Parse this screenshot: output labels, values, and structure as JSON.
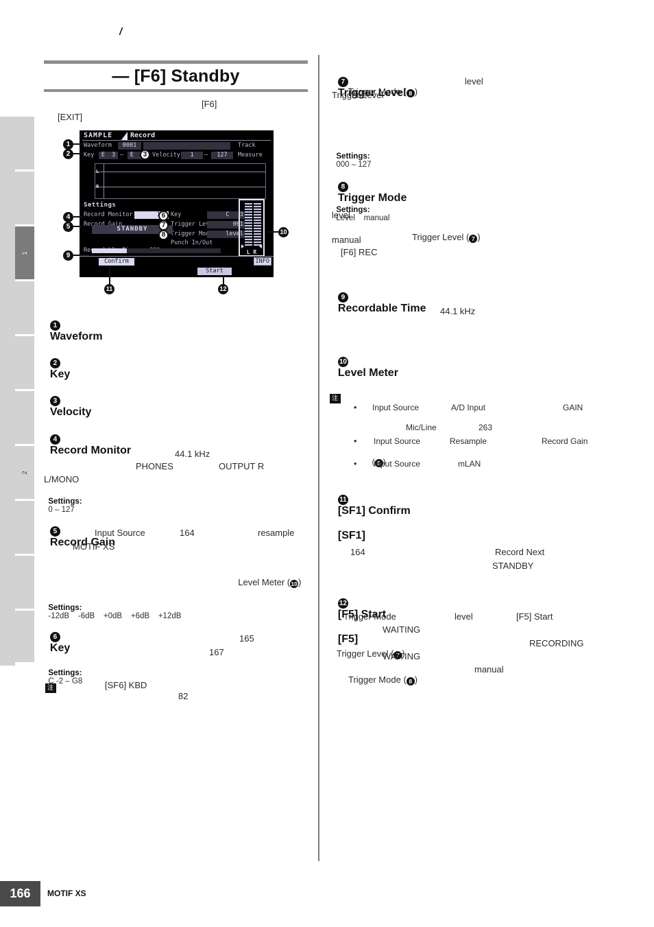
{
  "header": {
    "running_text": "/"
  },
  "title": {
    "text": "— [F6] Standby"
  },
  "intro": {
    "f6": "[F6]",
    "exit": "[EXIT]"
  },
  "lcd": {
    "mode": "SAMPLE",
    "page": "Record",
    "waveform_label": "Waveform",
    "waveform_value": "0001",
    "waveform_name": "",
    "track_label": "Track",
    "key_label": "Key",
    "key_low": "E  3",
    "key_dash": "–",
    "key_high": "E  3",
    "velocity_label": "Velocity",
    "velocity_low": "1",
    "velocity_dash": "–",
    "velocity_high": "127",
    "measure_label": "Measure",
    "ch_l": "L",
    "ch_r": "R",
    "settings_label": "Settings",
    "record_monitor_label": "Record Monitor",
    "record_monitor_value": "127",
    "record_gain_label": "Record Gain",
    "key2_label": "Key",
    "key2_value": "C   3",
    "trigger_level_label": "Trigger Level",
    "trigger_level_value": "001",
    "trigger_mode_label": "Trigger Mode",
    "trigger_mode_value": "level",
    "punch_label": "Punch In/Out",
    "standby_text": "STANDBY",
    "recordable_time_label": "Recordable Time:",
    "recordable_time_value": "380 sec",
    "meter_lr": "L R",
    "sf1_confirm": "Confirm",
    "f5_start": "Start",
    "info": "INFO",
    "progress_percent": 27
  },
  "callouts": {
    "c1": "1",
    "c2": "2",
    "c3": "3",
    "c4": "4",
    "c5": "5",
    "c6": "6",
    "c7": "7",
    "c8": "8",
    "c9": "9",
    "c10": "10",
    "c11": "11",
    "c12": "12"
  },
  "left_column": {
    "s1": {
      "num": "1",
      "heading": "Waveform"
    },
    "s2": {
      "num": "2",
      "heading": "Key"
    },
    "s3": {
      "num": "3",
      "heading": "Velocity"
    },
    "s4": {
      "num": "4",
      "heading": "Record Monitor",
      "body_1": "44.1 kHz",
      "body_2a": "PHONES",
      "body_2b": "OUTPUT R",
      "body_3": "L/MONO",
      "settings_label": "Settings:",
      "settings_value": "0 – 127"
    },
    "s5": {
      "num": "5",
      "heading": "Record Gain",
      "body_1a": "Input Source",
      "body_1b": "164",
      "body_1c": "resample",
      "body_2": "MOTIF XS",
      "body_3": "Level Meter (",
      "body_3_num": "10",
      "body_3_end": ")",
      "settings_label": "Settings:",
      "settings_value": "-12dB    -6dB    +0dB    +6dB    +12dB"
    },
    "s6": {
      "num": "6",
      "heading": "Key",
      "body_1": "165",
      "body_2": "167",
      "settings_label": "Settings:",
      "settings_value": "C -2 – G8",
      "note_badge": "注",
      "note_1": "[SF6] KBD",
      "note_2": "82"
    }
  },
  "right_column": {
    "s7": {
      "num": "7",
      "heading": "Trigger Level",
      "body_1a": "Trigger Mode (",
      "body_1_num": "8",
      "body_1b": ")",
      "body_1c": "level",
      "body_2": "Trigger Level",
      "settings_label": "Settings:",
      "settings_value": "000 – 127"
    },
    "s8": {
      "num": "8",
      "heading": "Trigger Mode",
      "settings_label": "Settings:",
      "settings_value": "Level    manual",
      "body_1": "level",
      "body_2a": "Trigger Level (",
      "body_2_num": "7",
      "body_2b": ")",
      "body_3": "manual",
      "body_4": "[F6] REC"
    },
    "s9": {
      "num": "9",
      "heading": "Recordable Time",
      "body_1": "44.1 kHz"
    },
    "s10": {
      "num": "10",
      "heading": "Level Meter",
      "note_badge": "注",
      "bullets": [
        {
          "a": "Input Source",
          "b": "A/D Input",
          "c": "GAIN",
          "d": "Mic/Line",
          "e": "263"
        },
        {
          "a": "Input Source",
          "b": "Resample",
          "c": "Record Gain",
          "d": "(",
          "d_num": "5",
          "e": ")"
        },
        {
          "a": "Input Source",
          "b": "mLAN",
          "c": "",
          "d": "",
          "e": ""
        }
      ]
    },
    "s11": {
      "num": "11",
      "heading_a": "[SF1] Confirm",
      "heading_b": "[SF1]",
      "body_1": "164",
      "body_2": "Record Next",
      "body_3": "STANDBY"
    },
    "s12": {
      "num": "12",
      "heading_a": "[F5] Start",
      "heading_b": "[F5]",
      "body_1a": "Trigger Mode",
      "body_1b": "level",
      "body_1c": "[F5] Start",
      "body_2": "WAITING",
      "body_3a": "Trigger Level (",
      "body_3_num": "7",
      "body_3b": ")",
      "body_3c": "RECORDING",
      "body_4": "WAITING",
      "body_5a": "Trigger Mode (",
      "body_5_num": "8",
      "body_5b": ")",
      "body_5c": "manual"
    }
  },
  "tabs": {
    "items": [
      {
        "label": "",
        "active": false
      },
      {
        "label": "",
        "active": false
      },
      {
        "label": "1",
        "active": true
      },
      {
        "label": "",
        "active": false
      },
      {
        "label": "",
        "active": false
      },
      {
        "label": "",
        "active": false
      },
      {
        "label": "2",
        "active": false
      },
      {
        "label": "",
        "active": false
      },
      {
        "label": "",
        "active": false
      },
      {
        "label": "",
        "active": false
      }
    ]
  },
  "footer": {
    "page_number": "166",
    "product": "MOTIF XS"
  }
}
